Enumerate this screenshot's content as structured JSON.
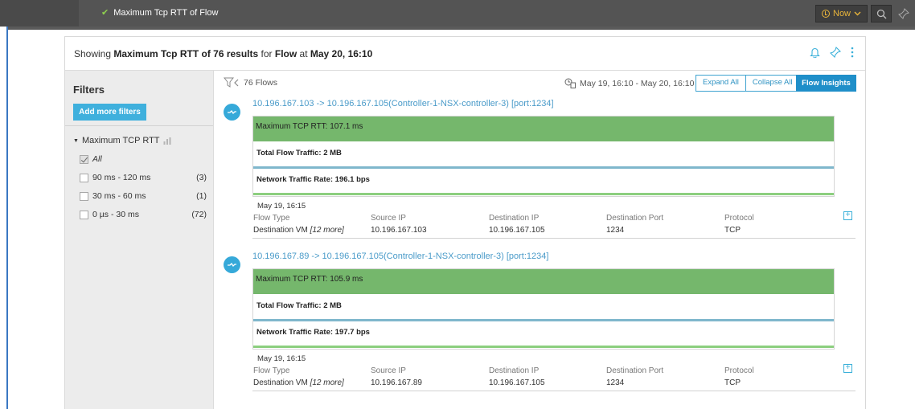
{
  "topbar": {
    "query": "Maximum Tcp RTT of Flow",
    "now_label": "Now",
    "icons": [
      "check-icon",
      "clock-icon",
      "chevron-down-icon",
      "search-icon",
      "pin-icon"
    ]
  },
  "header": {
    "prefix": "Showing ",
    "metric": "Maximum Tcp RTT of 76 results",
    "mid": " for ",
    "entity": "Flow",
    "at": " at ",
    "time": "May 20, 16:10",
    "icons": [
      "bell-icon",
      "pin-icon",
      "more-vertical-icon"
    ]
  },
  "filters": {
    "title": "Filters",
    "add_button": "Add more filters",
    "facet_title": "Maximum TCP RTT",
    "options": [
      {
        "label": "All",
        "count": "",
        "checked": true
      },
      {
        "label": "90 ms - 120 ms",
        "count": "(3)",
        "checked": false
      },
      {
        "label": "30 ms - 60 ms",
        "count": "(1)",
        "checked": false
      },
      {
        "label": "0 µs - 30 ms",
        "count": "(72)",
        "checked": false
      }
    ]
  },
  "toolbar": {
    "flow_count": "76 Flows",
    "date_range": "May 19, 16:10  -  May 20, 16:10",
    "expand_all": "Expand All",
    "collapse_all": "Collapse All",
    "flow_insights": "Flow Insights"
  },
  "meta_labels": {
    "flow_type": "Flow Type",
    "source_ip": "Source IP",
    "destination_ip": "Destination IP",
    "destination_port": "Destination Port",
    "protocol": "Protocol"
  },
  "flows": [
    {
      "title": "10.196.167.103 -> 10.196.167.105(Controller-1-NSX-controller-3) [port:1234]",
      "max_rtt": "Maximum TCP RTT: 107.1 ms",
      "total_traffic": "Total Flow Traffic: 2 MB",
      "traffic_rate": "Network Traffic Rate: 196.1 bps",
      "date": "May 19, 16:15",
      "flow_type": "Destination VM",
      "flow_type_more": "[12 more]",
      "source_ip": "10.196.167.103",
      "destination_ip": "10.196.167.105",
      "destination_port": "1234",
      "protocol": "TCP"
    },
    {
      "title": "10.196.167.89 -> 10.196.167.105(Controller-1-NSX-controller-3) [port:1234]",
      "max_rtt": "Maximum TCP RTT: 105.9 ms",
      "total_traffic": "Total Flow Traffic: 2 MB",
      "traffic_rate": "Network Traffic Rate: 197.7 bps",
      "date": "May 19, 16:15",
      "flow_type": "Destination VM",
      "flow_type_more": "[12 more]",
      "source_ip": "10.196.167.89",
      "destination_ip": "10.196.167.105",
      "destination_port": "1234",
      "protocol": "TCP"
    }
  ],
  "colors": {
    "accent": "#1f8fc9",
    "bar_green": "#75b76c",
    "topbar": "#545454",
    "now": "#e9b53b"
  }
}
